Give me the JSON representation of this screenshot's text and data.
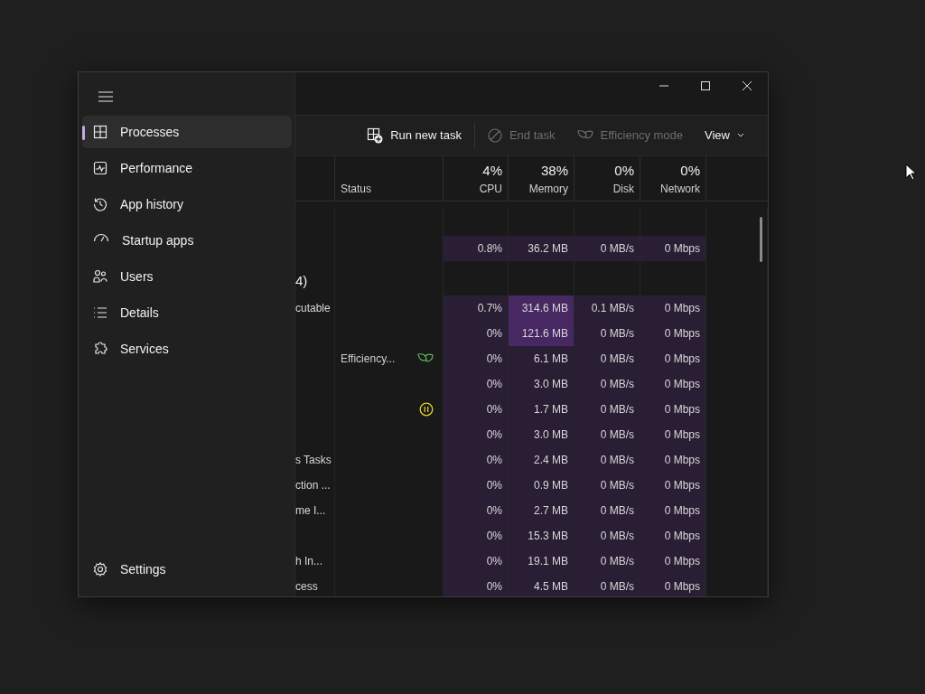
{
  "nav": {
    "items": [
      {
        "label": "Processes",
        "selected": true
      },
      {
        "label": "Performance",
        "selected": false
      },
      {
        "label": "App history",
        "selected": false
      },
      {
        "label": "Startup apps",
        "selected": false
      },
      {
        "label": "Users",
        "selected": false
      },
      {
        "label": "Details",
        "selected": false
      },
      {
        "label": "Services",
        "selected": false
      }
    ],
    "footer": {
      "label": "Settings"
    }
  },
  "toolbar": [
    {
      "label": "Run new task",
      "disabled": false,
      "kind": "run"
    },
    {
      "label": "End task",
      "disabled": true,
      "kind": "end"
    },
    {
      "label": "Efficiency mode",
      "disabled": true,
      "kind": "eco"
    },
    {
      "label": "View",
      "disabled": false,
      "kind": "menu"
    }
  ],
  "columns": [
    {
      "label": "Status"
    },
    {
      "usage": "4%",
      "label": "CPU"
    },
    {
      "usage": "38%",
      "label": "Memory"
    },
    {
      "usage": "0%",
      "label": "Disk"
    },
    {
      "usage": "0%",
      "label": "Network"
    }
  ],
  "groups": [
    {
      "rows": [
        {
          "cpu": "0.8%",
          "memory": "36.2 MB",
          "disk": "0 MB/s",
          "network": "0 Mbps",
          "memory_high": false,
          "efficiency_mode": false,
          "suspended": false
        }
      ]
    },
    {
      "label": "4)",
      "rows": [
        {
          "name": "cutable",
          "cpu": "0.7%",
          "memory": "314.6 MB",
          "disk": "0.1 MB/s",
          "network": "0 Mbps",
          "memory_high": true,
          "efficiency_mode": false,
          "suspended": false
        },
        {
          "cpu": "0%",
          "memory": "121.6 MB",
          "disk": "0 MB/s",
          "network": "0 Mbps",
          "memory_high": true,
          "efficiency_mode": false,
          "suspended": false
        },
        {
          "status": "Efficiency...",
          "cpu": "0%",
          "memory": "6.1 MB",
          "disk": "0 MB/s",
          "network": "0 Mbps",
          "memory_high": false,
          "efficiency_mode": true,
          "suspended": false
        },
        {
          "cpu": "0%",
          "memory": "3.0 MB",
          "disk": "0 MB/s",
          "network": "0 Mbps",
          "memory_high": false,
          "efficiency_mode": false,
          "suspended": false
        },
        {
          "cpu": "0%",
          "memory": "1.7 MB",
          "disk": "0 MB/s",
          "network": "0 Mbps",
          "memory_high": false,
          "efficiency_mode": false,
          "suspended": true
        },
        {
          "cpu": "0%",
          "memory": "3.0 MB",
          "disk": "0 MB/s",
          "network": "0 Mbps",
          "memory_high": false,
          "efficiency_mode": false,
          "suspended": false
        },
        {
          "name": "s Tasks",
          "cpu": "0%",
          "memory": "2.4 MB",
          "disk": "0 MB/s",
          "network": "0 Mbps",
          "memory_high": false,
          "efficiency_mode": false,
          "suspended": false
        },
        {
          "name": "ction ...",
          "cpu": "0%",
          "memory": "0.9 MB",
          "disk": "0 MB/s",
          "network": "0 Mbps",
          "memory_high": false,
          "efficiency_mode": false,
          "suspended": false
        },
        {
          "name": "me I...",
          "cpu": "0%",
          "memory": "2.7 MB",
          "disk": "0 MB/s",
          "network": "0 Mbps",
          "memory_high": false,
          "efficiency_mode": false,
          "suspended": false
        },
        {
          "cpu": "0%",
          "memory": "15.3 MB",
          "disk": "0 MB/s",
          "network": "0 Mbps",
          "memory_high": false,
          "efficiency_mode": false,
          "suspended": false
        },
        {
          "name": "h In...",
          "cpu": "0%",
          "memory": "19.1 MB",
          "disk": "0 MB/s",
          "network": "0 Mbps",
          "memory_high": false,
          "efficiency_mode": false,
          "suspended": false
        },
        {
          "name": "cess",
          "cpu": "0%",
          "memory": "4.5 MB",
          "disk": "0 MB/s",
          "network": "0 Mbps",
          "memory_high": false,
          "efficiency_mode": false,
          "suspended": false
        }
      ]
    }
  ]
}
